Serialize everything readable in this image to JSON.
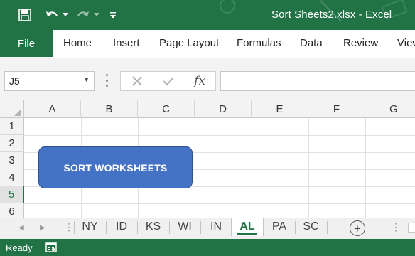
{
  "window": {
    "title": "Sort Sheets2.xlsx  -  Excel"
  },
  "qat": {
    "save_icon": "save-icon",
    "undo_icon": "undo-icon",
    "redo_icon": "redo-icon",
    "customize_icon": "customize-qat-icon"
  },
  "ribbon": {
    "file_label": "File",
    "tabs": [
      "Home",
      "Insert",
      "Page Layout",
      "Formulas",
      "Data",
      "Review",
      "View"
    ]
  },
  "formula_bar": {
    "name_box": "J5",
    "formula": "",
    "fx_label": "fx"
  },
  "grid": {
    "columns": [
      "A",
      "B",
      "C",
      "D",
      "E",
      "F",
      "G"
    ],
    "rows": [
      "1",
      "2",
      "3",
      "4",
      "5",
      "6"
    ],
    "active_row": "5"
  },
  "shape_button": {
    "label": "SORT WORKSHEETS"
  },
  "sheet_tabs": {
    "tabs": [
      "NY",
      "ID",
      "KS",
      "WI",
      "IN",
      "AL",
      "PA",
      "SC"
    ],
    "active": "AL",
    "add_label": "+"
  },
  "status": {
    "text": "Ready"
  },
  "colors": {
    "excel_green": "#217346",
    "button_blue": "#4472c4"
  }
}
